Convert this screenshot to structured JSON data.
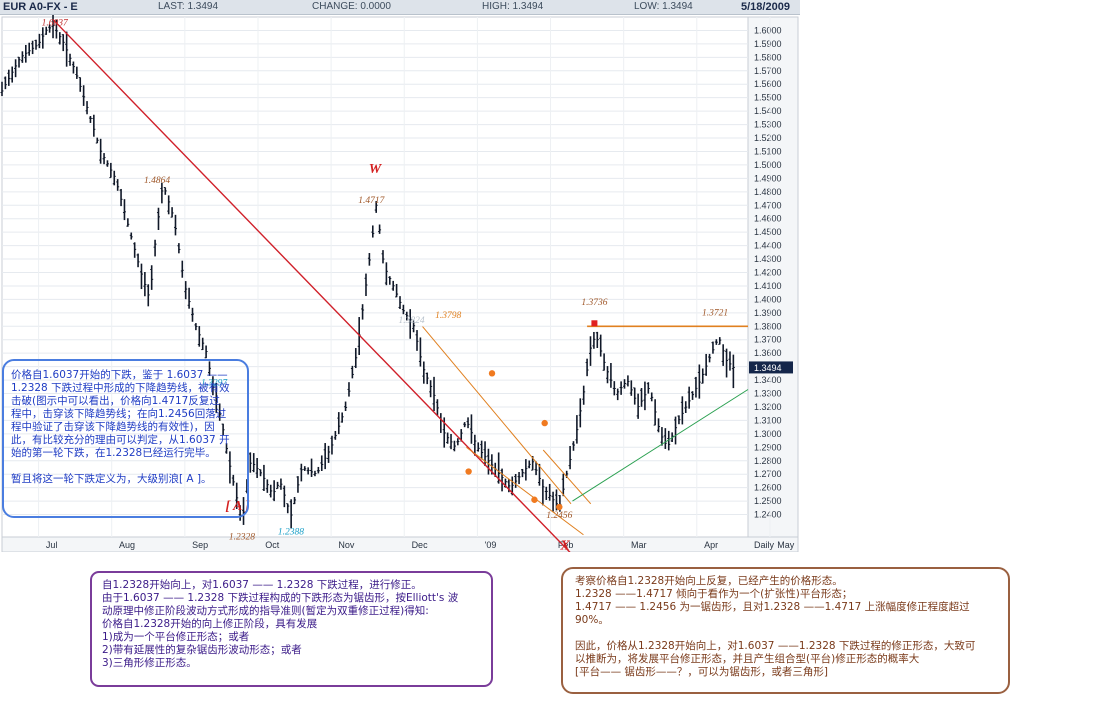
{
  "header": {
    "symbol": "EUR A0-FX - E",
    "last_label": "LAST: 1.3494",
    "change_label": "CHANGE: 0.0000",
    "high_label": "HIGH: 1.3494",
    "low_label": "LOW: 1.3494",
    "date": "5/18/2009"
  },
  "chart_data": {
    "type": "bar",
    "ylim": [
      1.2328,
      1.61
    ],
    "y_ticks": [
      "1.6000",
      "1.5900",
      "1.5800",
      "1.5700",
      "1.5600",
      "1.5500",
      "1.5400",
      "1.5300",
      "1.5200",
      "1.5100",
      "1.5000",
      "1.4900",
      "1.4800",
      "1.4700",
      "1.4600",
      "1.4500",
      "1.4400",
      "1.4300",
      "1.4200",
      "1.4100",
      "1.4000",
      "1.3900",
      "1.3800",
      "1.3700",
      "1.3600",
      "1.3500",
      "1.3400",
      "1.3300",
      "1.3200",
      "1.3100",
      "1.3000",
      "1.2900",
      "1.2800",
      "1.2700",
      "1.2600",
      "1.2500",
      "1.2400"
    ],
    "x_ticks": [
      {
        "label": "Jul",
        "month": 0
      },
      {
        "label": "Aug",
        "month": 1
      },
      {
        "label": "Sep",
        "month": 2
      },
      {
        "label": "Oct",
        "month": 3
      },
      {
        "label": "Nov",
        "month": 4
      },
      {
        "label": "Dec",
        "month": 5
      },
      {
        "label": "'09",
        "month": 6
      },
      {
        "label": "Feb",
        "month": 7
      },
      {
        "label": "Mar",
        "month": 8
      },
      {
        "label": "Apr",
        "month": 9
      },
      {
        "label": "May",
        "month": 10
      }
    ],
    "interval_label": "Daily",
    "last_price_tag": "1.3494",
    "price_path": [
      {
        "t": 0.0,
        "p": 1.555
      },
      {
        "t": 0.25,
        "p": 1.58
      },
      {
        "t": 0.5,
        "p": 1.59
      },
      {
        "t": 0.6,
        "p": 1.6
      },
      {
        "t": 0.7,
        "p": 1.6037
      },
      {
        "t": 0.85,
        "p": 1.59
      },
      {
        "t": 1.0,
        "p": 1.57
      },
      {
        "t": 1.15,
        "p": 1.545
      },
      {
        "t": 1.35,
        "p": 1.51
      },
      {
        "t": 1.55,
        "p": 1.49
      },
      {
        "t": 1.75,
        "p": 1.45
      },
      {
        "t": 1.9,
        "p": 1.42
      },
      {
        "t": 2.02,
        "p": 1.4
      },
      {
        "t": 2.1,
        "p": 1.445
      },
      {
        "t": 2.2,
        "p": 1.4864
      },
      {
        "t": 2.35,
        "p": 1.46
      },
      {
        "t": 2.5,
        "p": 1.41
      },
      {
        "t": 2.65,
        "p": 1.38
      },
      {
        "t": 2.8,
        "p": 1.36
      },
      {
        "t": 2.9,
        "p": 1.3297
      },
      {
        "t": 3.0,
        "p": 1.31
      },
      {
        "t": 3.1,
        "p": 1.28
      },
      {
        "t": 3.2,
        "p": 1.255
      },
      {
        "t": 3.28,
        "p": 1.2328
      },
      {
        "t": 3.4,
        "p": 1.28
      },
      {
        "t": 3.55,
        "p": 1.27
      },
      {
        "t": 3.7,
        "p": 1.255
      },
      {
        "t": 3.8,
        "p": 1.265
      },
      {
        "t": 3.95,
        "p": 1.2388
      },
      {
        "t": 4.1,
        "p": 1.275
      },
      {
        "t": 4.3,
        "p": 1.27
      },
      {
        "t": 4.5,
        "p": 1.29
      },
      {
        "t": 4.7,
        "p": 1.32
      },
      {
        "t": 4.85,
        "p": 1.36
      },
      {
        "t": 4.95,
        "p": 1.4
      },
      {
        "t": 5.05,
        "p": 1.44
      },
      {
        "t": 5.12,
        "p": 1.4717
      },
      {
        "t": 5.22,
        "p": 1.425
      },
      {
        "t": 5.35,
        "p": 1.41
      },
      {
        "t": 5.5,
        "p": 1.39
      },
      {
        "t": 5.62,
        "p": 1.3824
      },
      {
        "t": 5.75,
        "p": 1.35
      },
      {
        "t": 5.9,
        "p": 1.33
      },
      {
        "t": 6.05,
        "p": 1.3
      },
      {
        "t": 6.2,
        "p": 1.29
      },
      {
        "t": 6.35,
        "p": 1.31
      },
      {
        "t": 6.5,
        "p": 1.29
      },
      {
        "t": 6.65,
        "p": 1.28
      },
      {
        "t": 6.8,
        "p": 1.27
      },
      {
        "t": 6.95,
        "p": 1.26
      },
      {
        "t": 7.1,
        "p": 1.27
      },
      {
        "t": 7.25,
        "p": 1.28
      },
      {
        "t": 7.4,
        "p": 1.26
      },
      {
        "t": 7.55,
        "p": 1.25
      },
      {
        "t": 7.62,
        "p": 1.2456
      },
      {
        "t": 7.72,
        "p": 1.27
      },
      {
        "t": 7.85,
        "p": 1.3
      },
      {
        "t": 7.95,
        "p": 1.33
      },
      {
        "t": 8.05,
        "p": 1.365
      },
      {
        "t": 8.12,
        "p": 1.3736
      },
      {
        "t": 8.25,
        "p": 1.35
      },
      {
        "t": 8.4,
        "p": 1.33
      },
      {
        "t": 8.55,
        "p": 1.34
      },
      {
        "t": 8.7,
        "p": 1.32
      },
      {
        "t": 8.85,
        "p": 1.335
      },
      {
        "t": 9.0,
        "p": 1.3
      },
      {
        "t": 9.1,
        "p": 1.29
      },
      {
        "t": 9.25,
        "p": 1.31
      },
      {
        "t": 9.4,
        "p": 1.325
      },
      {
        "t": 9.55,
        "p": 1.34
      },
      {
        "t": 9.7,
        "p": 1.36
      },
      {
        "t": 9.8,
        "p": 1.3721
      },
      {
        "t": 9.9,
        "p": 1.355
      },
      {
        "t": 10.0,
        "p": 1.3494
      }
    ],
    "annotations": [
      {
        "label": "1.6037",
        "t": 0.72,
        "p": 1.6037,
        "color": "#c03030"
      },
      {
        "label": "1.4864",
        "t": 2.12,
        "p": 1.4864,
        "color": "#a0582a"
      },
      {
        "label": "1.4717",
        "t": 5.05,
        "p": 1.4717,
        "color": "#a0582a"
      },
      {
        "label": "W",
        "t": 5.1,
        "p": 1.494,
        "color": "#d42020"
      },
      {
        "label": "1.3297",
        "t": 2.9,
        "p": 1.336,
        "color": "#1aa0c8"
      },
      {
        "label": "1.3824",
        "t": 5.6,
        "p": 1.3824,
        "color": "#b8c2cc"
      },
      {
        "label": "1.3798",
        "t": 6.1,
        "p": 1.386,
        "color": "#e08020"
      },
      {
        "label": "1.3736",
        "t": 8.1,
        "p": 1.396,
        "color": "#a0582a"
      },
      {
        "label": "1.3721",
        "t": 9.75,
        "p": 1.388,
        "color": "#a0582a"
      },
      {
        "label": "[ A ]",
        "t": 3.22,
        "p": 1.2435,
        "color": "#d42020"
      },
      {
        "label": "1.2328",
        "t": 3.28,
        "p": 1.2215,
        "color": "#a0582a"
      },
      {
        "label": "1.2388",
        "t": 3.95,
        "p": 1.225,
        "color": "#1aa0c8"
      },
      {
        "label": "1.2456",
        "t": 7.62,
        "p": 1.2375,
        "color": "#a0582a"
      },
      {
        "label": "X",
        "t": 7.7,
        "p": 1.214,
        "color": "#d42020"
      }
    ]
  },
  "notes": {
    "left": [
      "价格自1.6037开始的下跌，鉴于 1.6037 ——",
      "1.2328 下跌过程中形成的下降趋势线，被有效",
      "击破(图示中可以看出，价格向1.4717反复过",
      "程中，击穿该下降趋势线；在向1.2456回落过",
      "程中验证了击穿该下降趋势线的有效性)，因",
      "此，有比较充分的理由可以判定，从1.6037 开",
      "始的第一轮下跌，在1.2328已经运行完毕。",
      "",
      "暂且将这一轮下跌定义为，大级别浪[ A ]。"
    ],
    "bottom": [
      "自1.2328开始向上，对1.6037 —— 1.2328 下跌过程，进行修正。",
      "由于1.6037 —— 1.2328 下跌过程构成的下跌形态为锯齿形，按Elliott's 波",
      "动原理中修正阶段波动方式形成的指导准则(暂定为双重修正过程)得知:",
      "价格自1.2328开始的向上修正阶段，具有发展",
      "1)成为一个平台修正形态；或者",
      "2)带有延展性的复杂锯齿形波动形态；或者",
      "3)三角形修正形态。"
    ],
    "right": [
      "考察价格自1.2328开始向上反复，已经产生的价格形态。",
      "1.2328 ——1.4717 倾向于看作为一个(扩张性)平台形态；",
      "1.4717 —— 1.2456 为一锯齿形，且对1.2328 ——1.4717 上涨幅度修正程度超过",
      "90%。",
      "",
      "因此，价格从1.2328开始向上，对1.6037 ——1.2328 下跌过程的修正形态，大致可",
      "以推断为，将发展平台修正形态，并且产生组合型(平台)修正形态的概率大",
      "[平台—— 锯齿形——？，可以为锯齿形，或者三角形]"
    ]
  }
}
